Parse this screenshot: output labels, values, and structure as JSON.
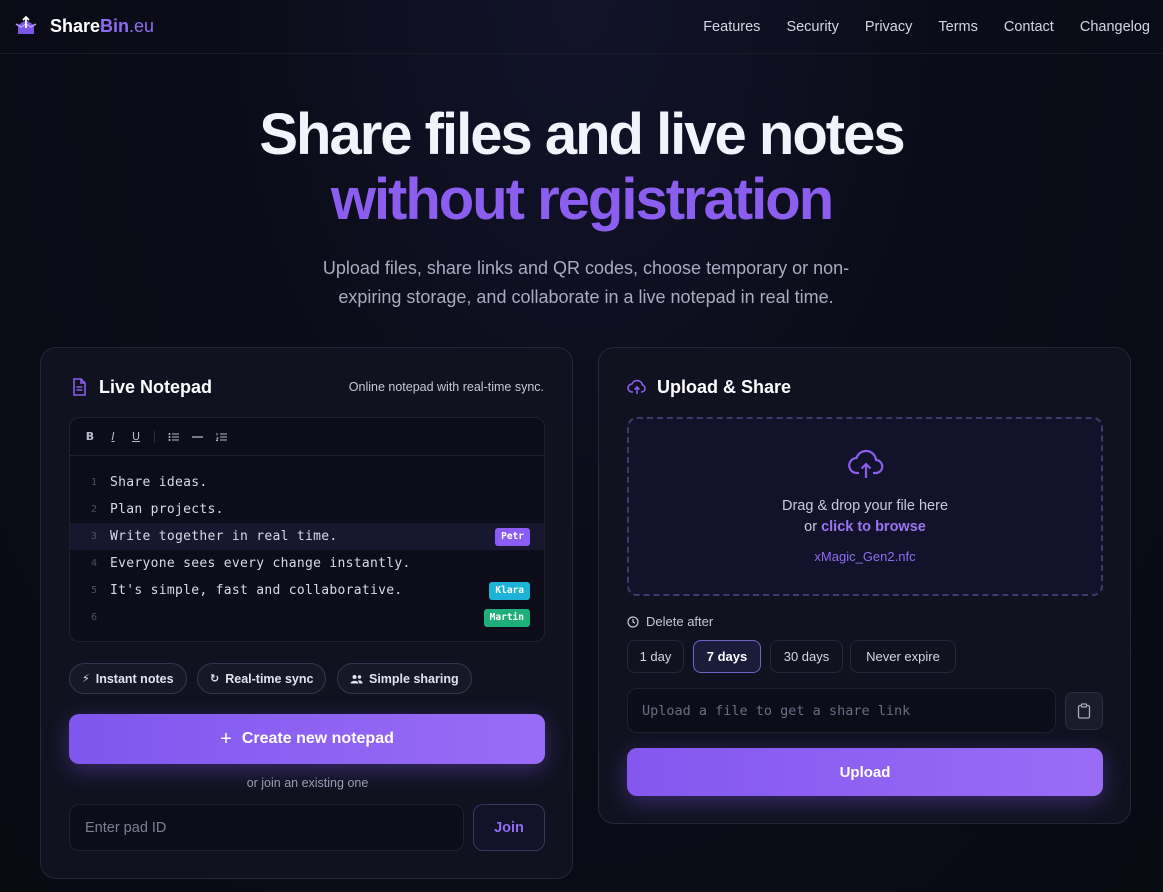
{
  "nav": {
    "brand_main": "Share",
    "brand_accent": "Bin",
    "brand_tld": ".eu",
    "links": [
      "Features",
      "Security",
      "Privacy",
      "Terms",
      "Contact",
      "Changelog"
    ]
  },
  "hero": {
    "title_line1": "Share files and live notes",
    "title_line2": "without registration",
    "subtitle_line1": "Upload files, share links and QR codes, choose temporary or non-",
    "subtitle_line2": "expiring storage, and collaborate in a live notepad in real time."
  },
  "notepad": {
    "title": "Live Notepad",
    "subtitle": "Online notepad with real-time sync.",
    "toolbar": [
      "B",
      "I",
      "U",
      "list",
      "rule",
      "ordered-list"
    ],
    "lines": [
      {
        "num": "1",
        "text": "Share ideas.",
        "cursor": null
      },
      {
        "num": "2",
        "text": "Plan projects.",
        "cursor": null
      },
      {
        "num": "3",
        "text": "Write together in real time.",
        "cursor": "Petr",
        "active": true
      },
      {
        "num": "4",
        "text": "Everyone sees every change instantly.",
        "cursor": null
      },
      {
        "num": "5",
        "text": "It's simple, fast and collaborative.",
        "cursor": "Klara"
      },
      {
        "num": "6",
        "text": "",
        "cursor": "Martin"
      }
    ],
    "cursor_colors": {
      "Petr": "#8b5cf6",
      "Klara": "#1eb3d6",
      "Martin": "#1fae7a"
    },
    "pills": [
      "Instant notes",
      "Real-time sync",
      "Simple sharing"
    ],
    "create_label": "Create new notepad",
    "or_join": "or join an existing one",
    "pad_placeholder": "Enter pad ID",
    "join_label": "Join"
  },
  "upload": {
    "title": "Upload & Share",
    "drop_text": "Drag & drop your file here",
    "drop_or": "or",
    "browse": "click to browse",
    "file_name": "xMagic_Gen2.nfc",
    "delete_after": "Delete after",
    "options": [
      "1 day",
      "7 days",
      "30 days",
      "Never expire"
    ],
    "selected_option": "7 days",
    "link_placeholder": "Upload a file to get a share link",
    "upload_label": "Upload"
  },
  "colors": {
    "accent": "#8b5ef0",
    "background": "#0b0c18",
    "card": "#111220"
  }
}
